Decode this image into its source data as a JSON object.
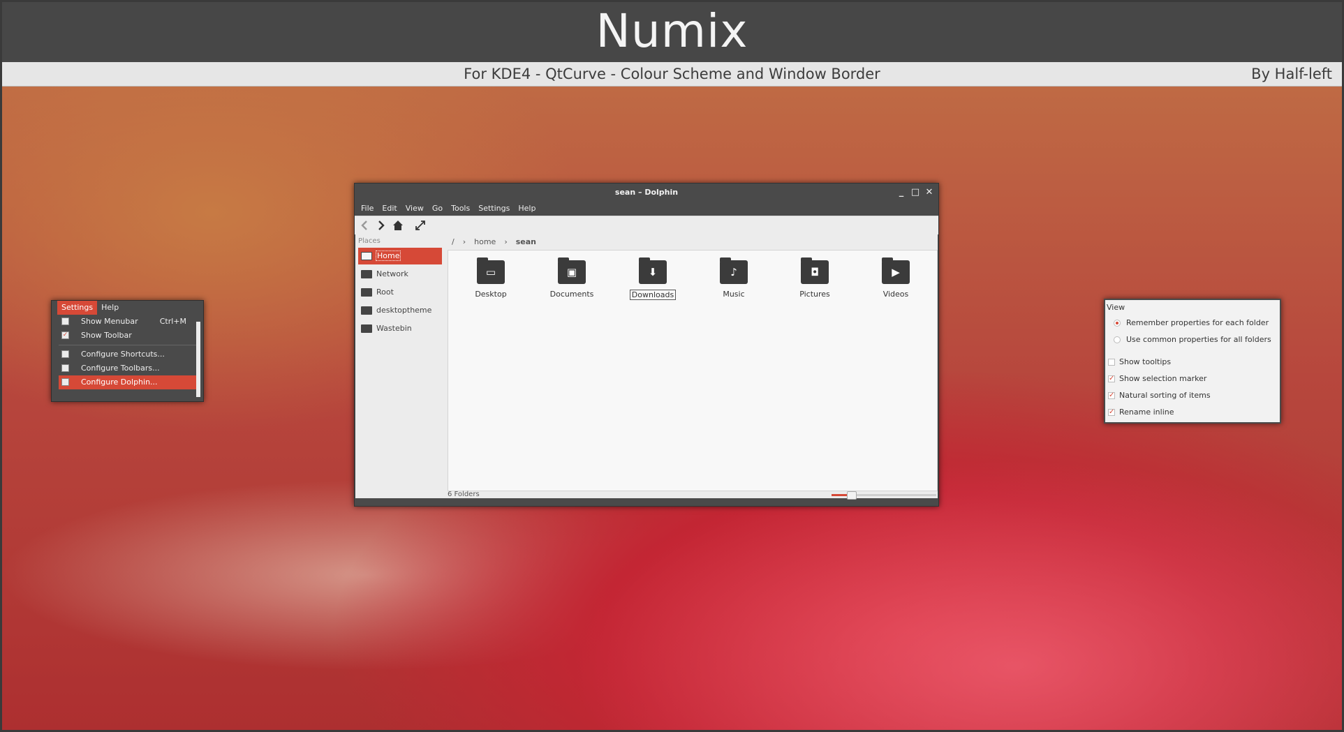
{
  "banner": {
    "title": "Numix",
    "subtitle": "For KDE4 - QtCurve - Colour Scheme and Window Border",
    "author": "By Half-left"
  },
  "colors": {
    "accent": "#d64937",
    "window_dark": "#4a4a4a",
    "window_light": "#ececec"
  },
  "dolphin": {
    "title": "sean – Dolphin",
    "menu": [
      "File",
      "Edit",
      "View",
      "Go",
      "Tools",
      "Settings",
      "Help"
    ],
    "toolbar_icons": [
      "back-icon",
      "forward-icon",
      "home-icon",
      "fullscreen-icon"
    ],
    "places_title": "Places",
    "places": [
      {
        "label": "Home",
        "icon": "home-folder-icon",
        "selected": true
      },
      {
        "label": "Network",
        "icon": "network-icon"
      },
      {
        "label": "Root",
        "icon": "drive-icon"
      },
      {
        "label": "desktoptheme",
        "icon": "folder-icon"
      },
      {
        "label": "Wastebin",
        "icon": "trash-icon"
      }
    ],
    "breadcrumb": [
      "/",
      "home",
      "sean"
    ],
    "folders": [
      {
        "label": "Desktop",
        "glyph": "▭"
      },
      {
        "label": "Documents",
        "glyph": "▣"
      },
      {
        "label": "Downloads",
        "glyph": "⬇"
      },
      {
        "label": "Music",
        "glyph": "♪"
      },
      {
        "label": "Pictures",
        "glyph": "◘"
      },
      {
        "label": "Videos",
        "glyph": "▶"
      }
    ],
    "status": "6 Folders",
    "zoom_fraction": 0.16
  },
  "settings_menu": {
    "menubar": [
      "Settings",
      "Help"
    ],
    "items": [
      {
        "label": "Show Menubar",
        "shortcut": "Ctrl+M"
      },
      {
        "label": "Show Toolbar"
      },
      {
        "label": "Configure Shortcuts..."
      },
      {
        "label": "Configure Toolbars..."
      },
      {
        "label": "Configure Dolphin..."
      }
    ]
  },
  "view_settings": {
    "title": "View",
    "radios": [
      "Remember properties for each folder",
      "Use common properties for all folders"
    ],
    "checks": [
      "Show tooltips",
      "Show selection marker",
      "Natural sorting of items",
      "Rename inline"
    ]
  }
}
